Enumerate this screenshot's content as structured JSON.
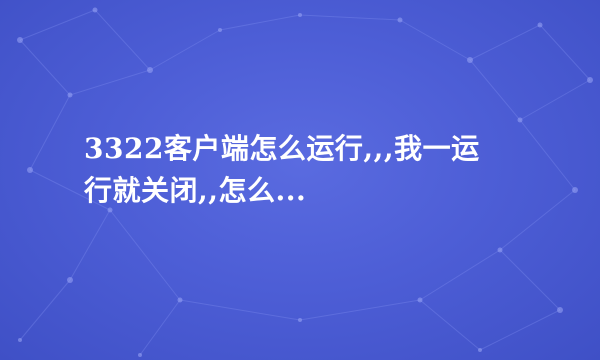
{
  "question": {
    "title_line1": "3322客户端怎么运行,,,我一运",
    "title_line2": "行就关闭,,怎么..."
  },
  "background": {
    "base_color": "#4a5bd0",
    "network_color": "#7f8ef0"
  }
}
